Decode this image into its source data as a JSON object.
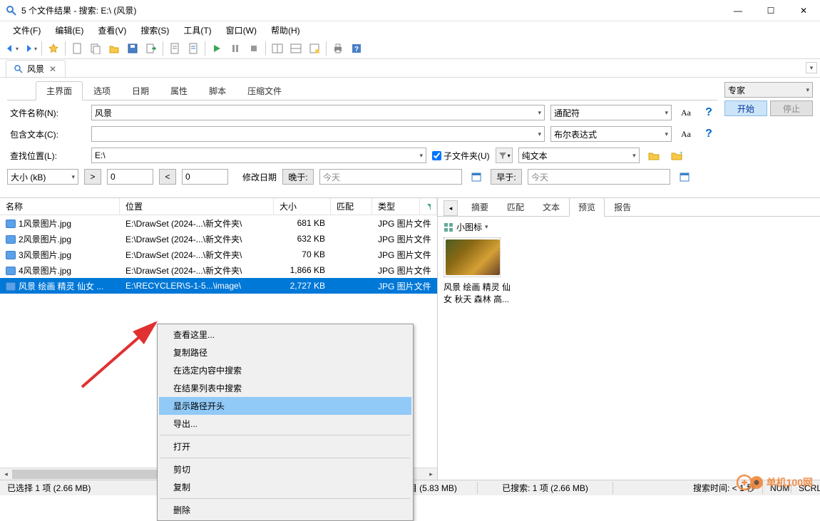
{
  "window": {
    "title": "5 个文件结果 - 搜索: E:\\ (风景)"
  },
  "menu": {
    "file": "文件(F)",
    "edit": "编辑(E)",
    "view": "查看(V)",
    "search": "搜索(S)",
    "tools": "工具(T)",
    "window": "窗口(W)",
    "help": "帮助(H)"
  },
  "doc_tab": {
    "label": "风景"
  },
  "mode": {
    "label": "专家"
  },
  "buttons": {
    "start": "开始",
    "stop": "停止"
  },
  "subtabs": [
    "主界面",
    "选项",
    "日期",
    "属性",
    "脚本",
    "压缩文件"
  ],
  "form": {
    "filename_label": "文件名称(N):",
    "filename_value": "风景",
    "filename_mode": "通配符",
    "contains_label": "包含文本(C):",
    "contains_value": "",
    "contains_mode": "布尔表达式",
    "lookin_label": "查找位置(L):",
    "lookin_value": "E:\\",
    "subfolders_label": "子文件夹(U)",
    "text_mode": "纯文本",
    "size_label": "大小 (kB)",
    "gt": ">",
    "lt": "<",
    "gt_val": "0",
    "lt_val": "0",
    "mod_date_label": "修改日期",
    "after_label": "晚于:",
    "before_label": "早于:",
    "after_ph": "今天",
    "before_ph": "今天"
  },
  "columns": {
    "name": "名称",
    "location": "位置",
    "size": "大小",
    "match": "匹配",
    "type": "类型"
  },
  "rows": [
    {
      "name": "1风景图片.jpg",
      "location": "E:\\DrawSet (2024-...\\新文件夹\\",
      "size": "681 KB",
      "type": "JPG 图片文件",
      "selected": false
    },
    {
      "name": "2风景图片.jpg",
      "location": "E:\\DrawSet (2024-...\\新文件夹\\",
      "size": "632 KB",
      "type": "JPG 图片文件",
      "selected": false
    },
    {
      "name": "3风景图片.jpg",
      "location": "E:\\DrawSet (2024-...\\新文件夹\\",
      "size": "70 KB",
      "type": "JPG 图片文件",
      "selected": false
    },
    {
      "name": "4风景图片.jpg",
      "location": "E:\\DrawSet (2024-...\\新文件夹\\",
      "size": "1,866 KB",
      "type": "JPG 图片文件",
      "selected": false
    },
    {
      "name": "风景 绘画 精灵 仙女 ...",
      "location": "E:\\RECYCLER\\S-1-5...\\image\\",
      "size": "2,727 KB",
      "type": "JPG 图片文件",
      "selected": true
    }
  ],
  "preview": {
    "tabs": [
      "摘要",
      "匹配",
      "文本",
      "预览",
      "报告"
    ],
    "viewmode": "小图标",
    "caption_l1": "风景 绘画 精灵 仙",
    "caption_l2": "女 秋天 森林 高..."
  },
  "context": {
    "items": [
      "查看这里...",
      "复制路径",
      "在选定内容中搜索",
      "在结果列表中搜索",
      "显示路径开头",
      "导出...",
      "打开",
      "剪切",
      "复制",
      "删除"
    ],
    "highlight_index": 4,
    "separators_after": [
      5,
      6,
      8
    ]
  },
  "status": {
    "selection": "已选择 1 项 (2.66 MB)",
    "found": "找到: 5 个项目 (5.83 MB)",
    "searched": "已搜索: 1 项 (2.66 MB)",
    "time": "搜索时间: < 1 秒",
    "numlock": "NUM",
    "scrl": "SCRL"
  },
  "watermark": "单机100网"
}
